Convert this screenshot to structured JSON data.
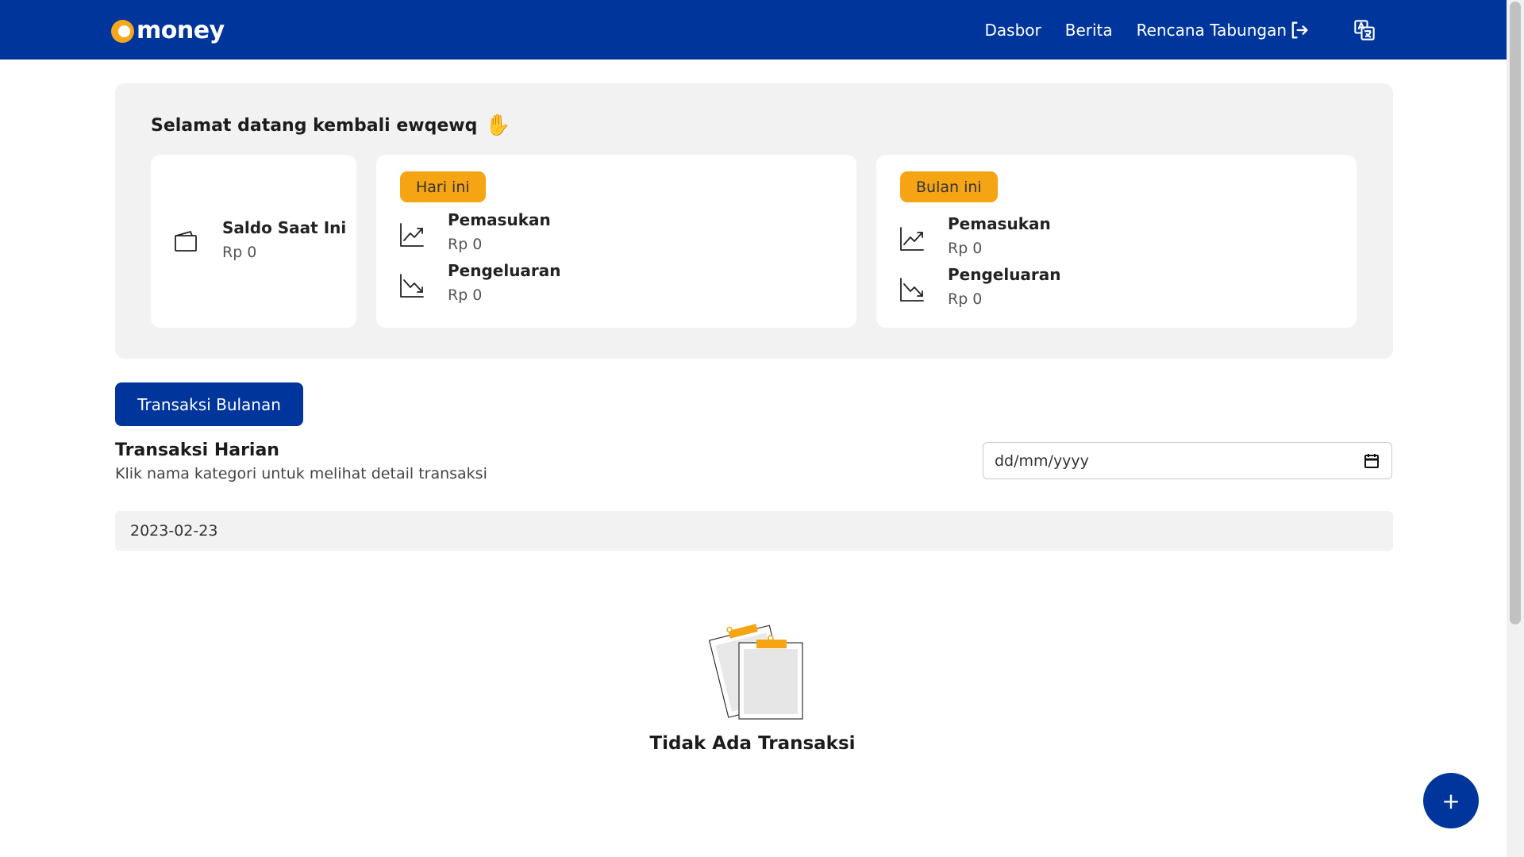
{
  "colors": {
    "primary": "#00369b",
    "accent": "#f5a414",
    "panel": "#f2f2f2"
  },
  "navbar": {
    "logo_text": "money",
    "links": [
      "Dasbor",
      "Berita",
      "Rencana Tabungan"
    ],
    "logout_icon": "logout-icon",
    "translate_icon": "translate-icon"
  },
  "welcome": {
    "title": "Selamat datang kembali ewqewq",
    "emoji": "✋",
    "balance": {
      "label": "Saldo Saat Ini",
      "value": "Rp 0",
      "icon": "wallet-icon"
    },
    "today": {
      "badge": "Hari ini",
      "income_label": "Pemasukan",
      "income_value": "Rp 0",
      "expense_label": "Pengeluaran",
      "expense_value": "Rp 0"
    },
    "month": {
      "badge": "Bulan ini",
      "income_label": "Pemasukan",
      "income_value": "Rp 0",
      "expense_label": "Pengeluaran",
      "expense_value": "Rp 0"
    }
  },
  "monthly_button": "Transaksi Bulanan",
  "daily": {
    "title": "Transaksi Harian",
    "subtitle": "Klik nama kategori untuk melihat detail transaksi",
    "date_placeholder": "dd/mm/yyyy",
    "date_group": "2023-02-23"
  },
  "empty": {
    "text": "Tidak Ada Transaksi"
  },
  "fab_label": "+"
}
